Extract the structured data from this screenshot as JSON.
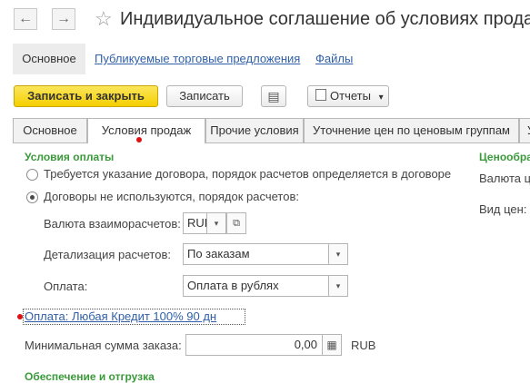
{
  "window": {
    "title": "Индивидуальное соглашение об условиях продаж"
  },
  "nav": {
    "back": "←",
    "forward": "→",
    "star": "☆",
    "items": [
      "Основное",
      "Публикуемые торговые предложения",
      "Файлы"
    ]
  },
  "toolbar": {
    "save_close": "Записать и закрыть",
    "save": "Записать",
    "list_icon": "▤",
    "reports": "Отчеты",
    "reports_arrow": "▾"
  },
  "tabs": [
    "Основное",
    "Условия продаж",
    "Прочие условия",
    "Уточнение цен по ценовым группам",
    "У"
  ],
  "payment": {
    "title": "Условия оплаты",
    "radio1": "Требуется указание договора, порядок расчетов определяется в договоре",
    "radio2": "Договоры не используются, порядок расчетов:",
    "currency_label": "Валюта взаиморасчетов:",
    "currency_value": "RUB",
    "detail_label": "Детализация расчетов:",
    "detail_value": "По заказам",
    "pay_label": "Оплата:",
    "pay_value": "Оплата в рублях",
    "schedule_link": "Оплата: Любая Кредит 100% 90 дн",
    "min_label": "Минимальная сумма заказа:",
    "min_value": "0,00",
    "min_currency": "RUB"
  },
  "pricing": {
    "title": "Ценообра",
    "currency_label": "Валюта ц",
    "kind_label": "Вид цен:"
  },
  "shipping": {
    "title": "Обеспечение и отгрузка"
  },
  "icons": {
    "dropdown": "▾",
    "open": "⧉",
    "calc": "▦"
  }
}
